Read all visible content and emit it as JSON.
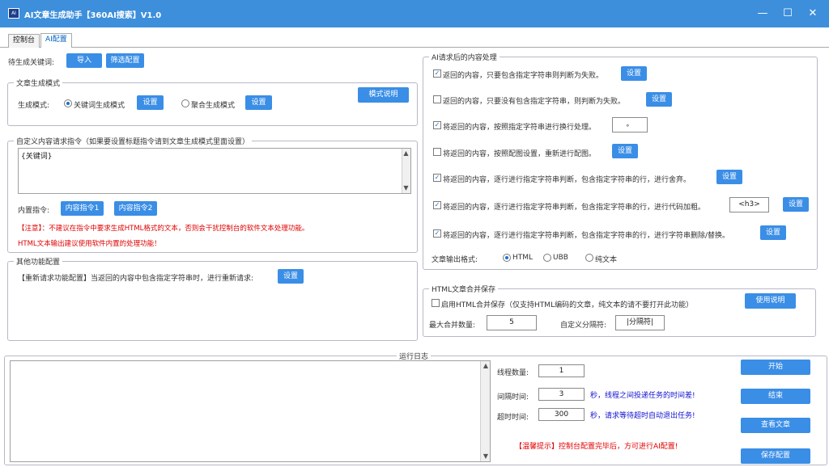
{
  "window": {
    "title": "AI文章生成助手【360AI搜索】V1.0",
    "icon_name": "app-logo-icon",
    "minimize_glyph": "—",
    "maximize_glyph": "☐",
    "close_glyph": "✕"
  },
  "tabs": [
    {
      "label": "控制台",
      "active": false
    },
    {
      "label": "AI配置",
      "active": true
    }
  ],
  "keyword": {
    "label": "待生成关键词:",
    "import_btn": "导入",
    "filter_btn": "筛选配置"
  },
  "mode_group": {
    "title": "文章生成模式",
    "label": "生成模式:",
    "option1": "关键词生成模式",
    "option2": "聚合生成模式",
    "settings_btn1": "设置",
    "settings_btn2": "设置",
    "explain_btn": "模式说明",
    "selected": "关键词生成模式"
  },
  "custom_group": {
    "title": "自定义内容请求指令（如果要设置标题指令请到文章生成模式里面设置）",
    "textarea_value": "{关键词}",
    "builtin_label": "内置指令:",
    "builtin_btn1": "内容指令1",
    "builtin_btn2": "内容指令2",
    "notice1": "【注意】：不建议在指令中要求生成HTML格式的文本，否则会干扰控制台的软件文本处理功能。",
    "notice2": "HTML文本输出建议使用软件内置的处理功能！"
  },
  "other_group": {
    "title": "其他功能配置",
    "text": "【重新请求功能配置】当返回的内容中包含指定字符串时，进行重新请求:",
    "settings_btn": "设置"
  },
  "post_group": {
    "title": "AI请求后的内容处理",
    "rows": [
      {
        "checked": true,
        "text": "返回的内容，只要包含指定字符串则判断为失败。",
        "btn": "设置",
        "value": ""
      },
      {
        "checked": false,
        "text": "返回的内容，只要没有包含指定字符串，则判断为失败。",
        "btn": "设置",
        "value": ""
      },
      {
        "checked": true,
        "text": "将返回的内容，按照指定字符串进行换行处理。",
        "btn": "",
        "value": "。"
      },
      {
        "checked": false,
        "text": "将返回的内容，按照配图设置，重新进行配图。",
        "btn": "设置",
        "value": ""
      },
      {
        "checked": true,
        "text": "将返回的内容，逐行进行指定字符串判断，包含指定字符串的行，进行舍弃。",
        "btn": "设置",
        "value": ""
      },
      {
        "checked": true,
        "text": "将返回的内容，逐行进行指定字符串判断，包含指定字符串的行，进行代码加粗。",
        "btn": "设置",
        "value": "<h3>"
      },
      {
        "checked": true,
        "text": "将返回的内容，逐行进行指定字符串判断，包含指定字符串的行，进行字符串删除/替换。",
        "btn": "设置",
        "value": ""
      }
    ],
    "output_label": "文章输出格式:",
    "formats": [
      "HTML",
      "UBB",
      "纯文本"
    ],
    "selected_format": "HTML"
  },
  "merge_group": {
    "title": "HTML文章合并保存",
    "checkbox_label": "启用HTML合并保存（仅支持HTML编码的文章，纯文本的请不要打开此功能）",
    "checked": false,
    "usage_btn": "使用说明",
    "max_label": "最大合并数量:",
    "max_value": "5",
    "sep_label": "自定义分隔符:",
    "sep_value": "|分隔符|"
  },
  "log_group": {
    "title": "运行日志",
    "thread_label": "线程数量:",
    "thread_value": "1",
    "interval_label": "间隔时间:",
    "interval_value": "3",
    "interval_hint": "秒，线程之间投递任务的时间差!",
    "timeout_label": "超时时间:",
    "timeout_value": "300",
    "timeout_hint": "秒，请求等待超时自动退出任务!",
    "tip": "【温馨提示】控制台配置完毕后，方可进行AI配置!",
    "start_btn": "开始",
    "stop_btn": "结束",
    "view_btn": "查看文章",
    "save_btn": "保存配置"
  },
  "colors": {
    "titlebar": "#3d8fdc",
    "button": "#3a8ee6",
    "notice_red": "#e00000",
    "hint_blue": "#1010d0"
  }
}
